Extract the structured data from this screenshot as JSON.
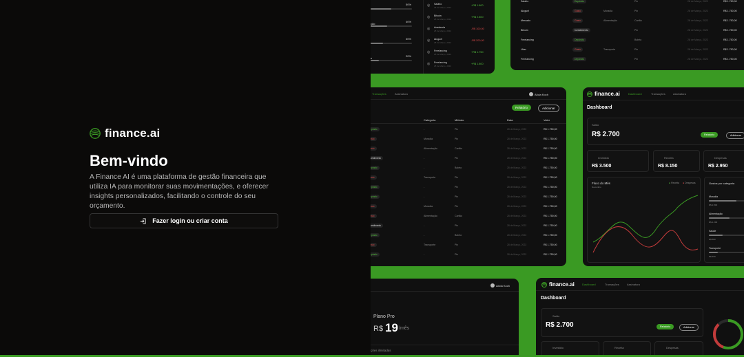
{
  "brand": {
    "name": "finance.ai"
  },
  "welcome": {
    "title": "Bem-vindo",
    "description": "A Finance AI é uma plataforma de gestão financeira que utiliza IA para monitorar suas movimentações, e oferecer insights personalizados, facilitando o controle do seu orçamento.",
    "login_label": "Fazer login ou criar conta"
  },
  "preview": {
    "progress_rows": [
      {
        "label": "",
        "pct": "50%",
        "fill": 0.5
      },
      {
        "label": "ção",
        "pct": "40%",
        "fill": 0.4
      },
      {
        "label": "",
        "pct": "30%",
        "fill": 0.3
      },
      {
        "label": "e",
        "pct": "20%",
        "fill": 0.2
      }
    ],
    "recent": [
      {
        "name": "Salário",
        "amount": "+R$ 1.800",
        "kind": "g"
      },
      {
        "name": "Bitcoin",
        "amount": "+R$ 2.800",
        "kind": "g"
      },
      {
        "name": "Academia",
        "amount": "-R$ 100,00",
        "kind": "r"
      },
      {
        "name": "Aluguel",
        "amount": "-R$ 200,00",
        "kind": "r"
      },
      {
        "name": "Freelancing",
        "amount": "+R$ 1.750",
        "kind": "g"
      },
      {
        "name": "Freelancing",
        "amount": "+R$ 1.800",
        "kind": "g"
      }
    ],
    "top_table": [
      {
        "name": "Salário",
        "type": "Depósito",
        "cat": "",
        "method": "Pix",
        "date": "28 de Março, 2022",
        "val": "R$ 1.750,00"
      },
      {
        "name": "Aluguel",
        "type": "Gasto",
        "cat": "Moradia",
        "method": "Pix",
        "date": "28 de Março, 2022",
        "val": "R$ 1.750,00"
      },
      {
        "name": "Mercado",
        "type": "Gasto",
        "cat": "Alimentação",
        "method": "Cartão",
        "date": "28 de Março, 2022",
        "val": "R$ 1.750,00"
      },
      {
        "name": "Bitcoin",
        "type": "Investimento",
        "cat": "",
        "method": "Pix",
        "date": "28 de Março, 2022",
        "val": "R$ 1.750,00"
      },
      {
        "name": "Freelancing",
        "type": "Depósito",
        "cat": "",
        "method": "Boleto",
        "date": "28 de Março, 2022",
        "val": "R$ 1.750,00"
      },
      {
        "name": "Uber",
        "type": "Gasto",
        "cat": "Transporte",
        "method": "Pix",
        "date": "28 de Março, 2022",
        "val": "R$ 1.750,00"
      },
      {
        "name": "Freelancing",
        "type": "Depósito",
        "cat": "",
        "method": "Pix",
        "date": "28 de Março, 2022",
        "val": "R$ 1.750,00"
      }
    ],
    "nav_tabs": {
      "dashboard": "Dashboard",
      "transactions": "Transações",
      "subscription": "Assinatura"
    },
    "user_name": "Alícia Koch",
    "table_headers": [
      "Categoria",
      "Método",
      "Data",
      "Valor"
    ],
    "buttons": {
      "reports": "Relatório",
      "add": "Adicionar"
    },
    "mid_rows": [
      {
        "type": "Depósito",
        "cat": "-",
        "method": "Pix"
      },
      {
        "type": "Gasto",
        "cat": "Moradia",
        "method": "Pix"
      },
      {
        "type": "Gasto",
        "cat": "Alimentação",
        "method": "Cartão"
      },
      {
        "type": "Investimento",
        "cat": "-",
        "method": "Pix"
      },
      {
        "type": "Depósito",
        "cat": "-",
        "method": "Boleto"
      },
      {
        "type": "Gasto",
        "cat": "Transporte",
        "method": "Pix"
      },
      {
        "type": "Depósito",
        "cat": "-",
        "method": "Pix"
      },
      {
        "type": "Depósito",
        "cat": "-",
        "method": "Pix"
      },
      {
        "type": "Gasto",
        "cat": "Moradia",
        "method": "Pix"
      },
      {
        "type": "Gasto",
        "cat": "Alimentação",
        "method": "Cartão"
      },
      {
        "type": "Investimento",
        "cat": "-",
        "method": "Pix"
      },
      {
        "type": "Depósito",
        "cat": "-",
        "method": "Boleto"
      },
      {
        "type": "Gasto",
        "cat": "Transporte",
        "method": "Pix"
      },
      {
        "type": "Depósito",
        "cat": "-",
        "method": "Pix"
      }
    ],
    "row_date": "28 de Março, 2022",
    "row_value": "R$ 1.750,00",
    "dashboard": {
      "title": "Dashboard",
      "balance_label": "Saldo",
      "balance": "R$ 2.700",
      "invested_label": "Investido",
      "invested": "R$ 3.500",
      "income_label": "Receita",
      "income": "R$ 8.150",
      "expenses_label": "Despesas",
      "expenses": "R$ 2.950",
      "flow_title": "Fluxo do Mês",
      "flow_sub": "Novembro",
      "legend_income": "Receita",
      "legend_expense": "Despesas",
      "cat_title": "Gastos por categoria",
      "categories": [
        {
          "name": "Moradia",
          "amount": "R$ 2.800",
          "fill": 0.6
        },
        {
          "name": "Alimentação",
          "amount": "R$ 1.200",
          "fill": 0.45
        },
        {
          "name": "Saúde",
          "amount": "R$ 580",
          "fill": 0.3
        },
        {
          "name": "Transporte",
          "amount": "R$ 300",
          "fill": 0.2
        }
      ]
    },
    "plan": {
      "name": "Plano Pro",
      "currency": "R$",
      "price": "19",
      "period": "/mês",
      "feature": "ções ilimitadas"
    }
  },
  "colors": {
    "accent": "#3a9a23",
    "income": "#55c23f",
    "expense": "#e14b4b"
  }
}
